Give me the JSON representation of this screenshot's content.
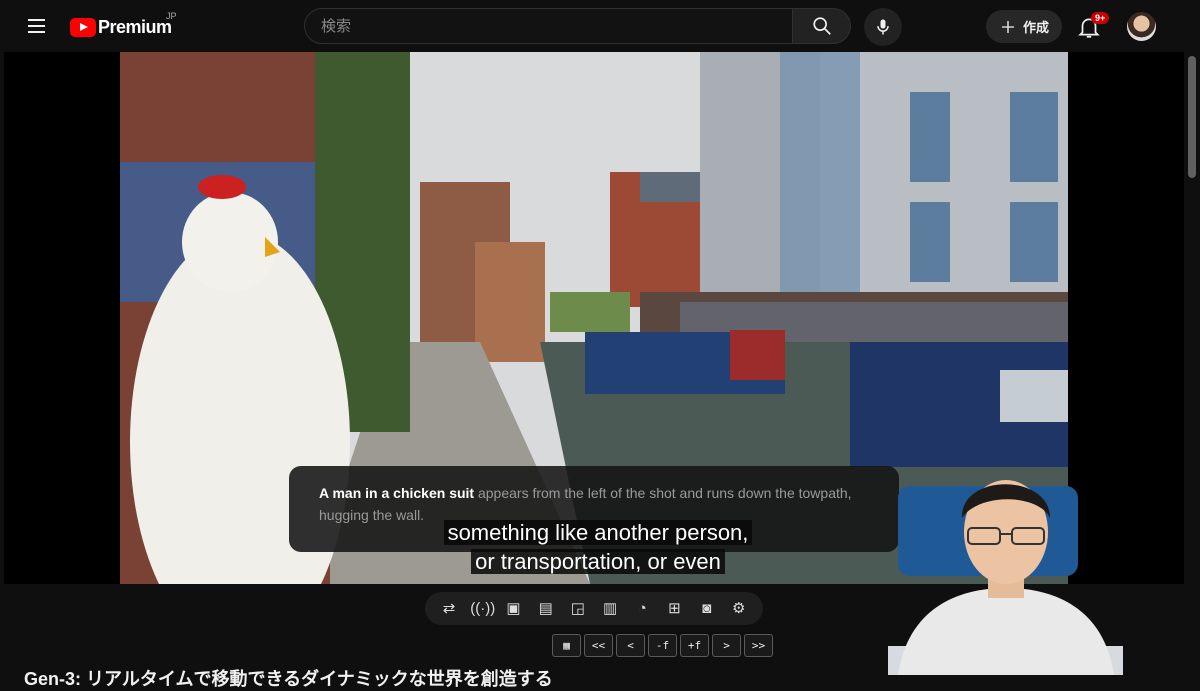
{
  "header": {
    "logo_text": "Premium",
    "region": "JP",
    "search_placeholder": "検索",
    "create_label": "作成",
    "notification_count": "9+"
  },
  "video": {
    "caption_highlight": "A man in a chicken suit",
    "caption_rest": " appears from the left of the shot and runs down the towpath, hugging the wall.",
    "subtitle_line1": "something like another person,",
    "subtitle_line2": "or transportation, or even"
  },
  "toolbar_icons": [
    "loop-icon",
    "broadcast-icon",
    "screen-view-icon",
    "clapper-icon",
    "picture-in-picture-icon",
    "cinema-icon",
    "speedometer-icon",
    "add-frame-icon",
    "camera-icon",
    "gear-icon"
  ],
  "keys": [
    "▦",
    "<<",
    "<",
    "-f",
    "+f",
    ">",
    ">>"
  ],
  "title": "Gen-3: リアルタイムで移動できるダイナミックな世界を創造する",
  "colors": {
    "brand": "#ff0000",
    "badge": "#cc0000",
    "background": "#0f0f0f"
  }
}
